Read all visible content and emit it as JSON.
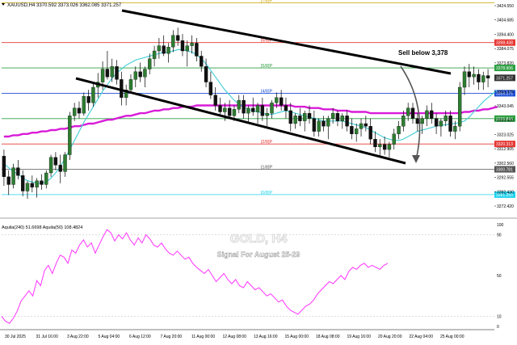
{
  "header": {
    "symbol_line": "XAUUSD,H4  3370.592  3373.026  3362.085  3371.257"
  },
  "watermark": {
    "title": "GOLD, H4",
    "subtitle": "Signal For August 25-29"
  },
  "annotation": {
    "text": "Sell below 3,378"
  },
  "oscillator": {
    "label": "Aquila(240) 51.6698  Aquila(50) 108.4824"
  },
  "colors": {
    "candle_bull": "#2e7d32",
    "candle_bear": "#111111",
    "ma_fast": "#4dd0d8",
    "ma_slow": "#d81bd8",
    "oscillator": "#ff33ff",
    "channel": "#000000",
    "murrey_green": "#2ea043",
    "murrey_red": "#e53935",
    "murrey_blue": "#1e4fd8",
    "murrey_cyan": "#22d3ee",
    "murrey_gray": "#555555",
    "murrey_yellow": "#c9a400"
  },
  "chart_data": [
    {
      "type": "candlestick",
      "title": "",
      "ylim": [
        3265,
        3430
      ],
      "y_ticks": [
        "3424.550",
        "3404.685",
        "3394.400",
        "3384.075",
        "3373.820",
        "3363.560",
        "3353.375",
        "3343.045",
        "3333.420",
        "3323.025",
        "3312.905",
        "3302.560",
        "3292.555",
        "3282.430",
        "3272.420"
      ],
      "x_ticks": [
        "30 Jul 2025",
        "31 Jul 16:00",
        "3 Aug 22:00",
        "5 Aug 04:00",
        "6 Aug 12:00",
        "7 Aug 20:00",
        "11 Aug 00:00",
        "12 Aug 08:00",
        "13 Aug 16:00",
        "15 Aug 00:00",
        "18 Aug 08:00",
        "19 Aug 16:00",
        "20 Aug 20:00",
        "22 Aug 04:00",
        "25 Aug 00:00"
      ],
      "levels": [
        {
          "label": "[7/8]P",
          "value": 3429.0,
          "color": "yellow",
          "price_label": ""
        },
        {
          "label": "[6/8]P",
          "value": 3398.438,
          "color": "red",
          "price_label": "3398.438"
        },
        {
          "label": "[5/8]P",
          "value": 3378.906,
          "color": "green",
          "price_label": "3378.906"
        },
        {
          "label": "[4/8]P",
          "value": 3359.375,
          "color": "blue",
          "price_label": "3359.375"
        },
        {
          "label": "",
          "value": 3339.844,
          "color": "green",
          "price_label": "3339.844"
        },
        {
          "label": "[2/8]P",
          "value": 3320.313,
          "color": "red",
          "price_label": "3320.313"
        },
        {
          "label": "[1/8]P",
          "value": 3300.781,
          "color": "gray",
          "price_label": "3300.781"
        },
        {
          "label": "[0/8]P",
          "value": 3281.25,
          "color": "cyan",
          "price_label": "3281.250"
        }
      ],
      "current_price": "3371.257",
      "candles": [
        [
          3311,
          3316,
          3288,
          3295
        ],
        [
          3295,
          3300,
          3281,
          3289
        ],
        [
          3289,
          3305,
          3286,
          3302
        ],
        [
          3302,
          3308,
          3293,
          3296
        ],
        [
          3296,
          3300,
          3280,
          3284
        ],
        [
          3284,
          3292,
          3278,
          3290
        ],
        [
          3290,
          3296,
          3283,
          3287
        ],
        [
          3287,
          3294,
          3279,
          3292
        ],
        [
          3292,
          3297,
          3285,
          3289
        ],
        [
          3289,
          3300,
          3286,
          3298
        ],
        [
          3298,
          3312,
          3295,
          3310
        ],
        [
          3310,
          3314,
          3300,
          3304
        ],
        [
          3304,
          3312,
          3290,
          3299
        ],
        [
          3299,
          3314,
          3295,
          3312
        ],
        [
          3312,
          3345,
          3308,
          3342
        ],
        [
          3342,
          3352,
          3338,
          3348
        ],
        [
          3348,
          3353,
          3340,
          3344
        ],
        [
          3344,
          3360,
          3342,
          3357
        ],
        [
          3357,
          3362,
          3346,
          3352
        ],
        [
          3352,
          3368,
          3349,
          3364
        ],
        [
          3364,
          3375,
          3356,
          3368
        ],
        [
          3368,
          3384,
          3362,
          3378
        ],
        [
          3378,
          3392,
          3370,
          3372
        ],
        [
          3372,
          3386,
          3368,
          3380
        ],
        [
          3380,
          3385,
          3366,
          3370
        ],
        [
          3370,
          3376,
          3350,
          3356
        ],
        [
          3356,
          3366,
          3350,
          3362
        ],
        [
          3362,
          3374,
          3359,
          3370
        ],
        [
          3370,
          3380,
          3364,
          3376
        ],
        [
          3376,
          3383,
          3368,
          3372
        ],
        [
          3372,
          3380,
          3364,
          3378
        ],
        [
          3378,
          3390,
          3374,
          3386
        ],
        [
          3386,
          3396,
          3380,
          3392
        ],
        [
          3392,
          3402,
          3386,
          3396
        ],
        [
          3396,
          3404,
          3388,
          3390
        ],
        [
          3390,
          3398,
          3383,
          3395
        ],
        [
          3395,
          3408,
          3391,
          3404
        ],
        [
          3404,
          3410,
          3396,
          3400
        ],
        [
          3400,
          3405,
          3388,
          3392
        ],
        [
          3392,
          3400,
          3380,
          3396
        ],
        [
          3396,
          3404,
          3390,
          3398
        ],
        [
          3398,
          3402,
          3384,
          3388
        ],
        [
          3388,
          3392,
          3376,
          3380
        ],
        [
          3380,
          3386,
          3364,
          3368
        ],
        [
          3368,
          3376,
          3355,
          3358
        ],
        [
          3358,
          3364,
          3346,
          3350
        ],
        [
          3350,
          3356,
          3342,
          3345
        ],
        [
          3345,
          3352,
          3338,
          3348
        ],
        [
          3348,
          3354,
          3340,
          3342
        ],
        [
          3342,
          3350,
          3338,
          3347
        ],
        [
          3347,
          3358,
          3344,
          3354
        ],
        [
          3354,
          3358,
          3340,
          3344
        ],
        [
          3344,
          3350,
          3336,
          3348
        ],
        [
          3348,
          3356,
          3342,
          3345
        ],
        [
          3345,
          3352,
          3336,
          3350
        ],
        [
          3350,
          3356,
          3338,
          3342
        ],
        [
          3342,
          3348,
          3334,
          3344
        ],
        [
          3344,
          3354,
          3340,
          3352
        ],
        [
          3352,
          3360,
          3348,
          3356
        ],
        [
          3356,
          3362,
          3346,
          3350
        ],
        [
          3350,
          3356,
          3340,
          3346
        ],
        [
          3346,
          3352,
          3330,
          3336
        ],
        [
          3336,
          3344,
          3332,
          3342
        ],
        [
          3342,
          3348,
          3334,
          3338
        ],
        [
          3338,
          3346,
          3330,
          3344
        ],
        [
          3344,
          3350,
          3336,
          3340
        ],
        [
          3340,
          3346,
          3326,
          3330
        ],
        [
          3330,
          3340,
          3326,
          3338
        ],
        [
          3338,
          3342,
          3330,
          3334
        ],
        [
          3334,
          3342,
          3324,
          3340
        ],
        [
          3340,
          3348,
          3336,
          3344
        ],
        [
          3344,
          3346,
          3334,
          3338
        ],
        [
          3338,
          3344,
          3332,
          3342
        ],
        [
          3342,
          3346,
          3330,
          3334
        ],
        [
          3334,
          3340,
          3324,
          3328
        ],
        [
          3328,
          3336,
          3322,
          3332
        ],
        [
          3332,
          3340,
          3326,
          3336
        ],
        [
          3336,
          3342,
          3330,
          3334
        ],
        [
          3334,
          3340,
          3320,
          3324
        ],
        [
          3324,
          3330,
          3314,
          3318
        ],
        [
          3318,
          3324,
          3310,
          3320
        ],
        [
          3320,
          3326,
          3312,
          3316
        ],
        [
          3316,
          3322,
          3310,
          3320
        ],
        [
          3320,
          3332,
          3316,
          3328
        ],
        [
          3328,
          3338,
          3324,
          3334
        ],
        [
          3334,
          3346,
          3330,
          3342
        ],
        [
          3342,
          3352,
          3338,
          3348
        ],
        [
          3348,
          3352,
          3336,
          3340
        ],
        [
          3340,
          3344,
          3330,
          3336
        ],
        [
          3336,
          3342,
          3328,
          3340
        ],
        [
          3340,
          3350,
          3334,
          3346
        ],
        [
          3346,
          3352,
          3336,
          3340
        ],
        [
          3340,
          3344,
          3328,
          3334
        ],
        [
          3334,
          3340,
          3326,
          3338
        ],
        [
          3338,
          3346,
          3334,
          3342
        ],
        [
          3342,
          3346,
          3326,
          3330
        ],
        [
          3330,
          3338,
          3324,
          3334
        ],
        [
          3334,
          3368,
          3330,
          3364
        ],
        [
          3364,
          3380,
          3358,
          3376
        ],
        [
          3376,
          3382,
          3364,
          3372
        ],
        [
          3372,
          3380,
          3366,
          3374
        ],
        [
          3374,
          3378,
          3362,
          3368
        ],
        [
          3368,
          3376,
          3362,
          3373
        ],
        [
          3373,
          3378,
          3364,
          3371
        ]
      ],
      "ma_fast": [
        3305,
        3302,
        3299,
        3297,
        3294,
        3292,
        3291,
        3290,
        3290,
        3291,
        3294,
        3298,
        3303,
        3309,
        3316,
        3323,
        3330,
        3337,
        3343,
        3349,
        3355,
        3361,
        3366,
        3371,
        3375,
        3378,
        3381,
        3383,
        3385,
        3386,
        3387,
        3388,
        3389,
        3390,
        3391,
        3391,
        3392,
        3393,
        3393,
        3392,
        3391,
        3389,
        3386,
        3382,
        3377,
        3372,
        3367,
        3362,
        3358,
        3354,
        3351,
        3349,
        3347,
        3346,
        3345,
        3344,
        3343,
        3343,
        3344,
        3345,
        3346,
        3345,
        3344,
        3343,
        3342,
        3341,
        3340,
        3339,
        3338,
        3338,
        3338,
        3338,
        3338,
        3337,
        3336,
        3335,
        3334,
        3333,
        3331,
        3329,
        3327,
        3325,
        3324,
        3323,
        3323,
        3324,
        3326,
        3328,
        3330,
        3331,
        3332,
        3333,
        3334,
        3335,
        3335,
        3336,
        3336,
        3337,
        3338,
        3341,
        3345,
        3349,
        3353,
        3356,
        3359,
        3362
      ],
      "ma_slow": [
        3326,
        3326,
        3327,
        3327,
        3328,
        3328,
        3329,
        3329,
        3330,
        3330,
        3331,
        3331,
        3332,
        3332,
        3333,
        3334,
        3334,
        3335,
        3336,
        3336,
        3337,
        3338,
        3339,
        3339,
        3340,
        3341,
        3342,
        3342,
        3343,
        3344,
        3344,
        3345,
        3346,
        3346,
        3347,
        3347,
        3348,
        3348,
        3349,
        3349,
        3349,
        3350,
        3350,
        3350,
        3350,
        3350,
        3350,
        3350,
        3350,
        3350,
        3350,
        3350,
        3350,
        3350,
        3350,
        3350,
        3350,
        3350,
        3350,
        3350,
        3350,
        3350,
        3349,
        3349,
        3349,
        3348,
        3348,
        3348,
        3347,
        3347,
        3347,
        3346,
        3346,
        3346,
        3345,
        3345,
        3345,
        3345,
        3344,
        3344,
        3344,
        3344,
        3344,
        3344,
        3344,
        3344,
        3344,
        3344,
        3344,
        3344,
        3344,
        3344,
        3344,
        3344,
        3344,
        3344,
        3344,
        3344,
        3345,
        3345,
        3346,
        3346,
        3347,
        3347,
        3348,
        3349
      ]
    },
    {
      "type": "line",
      "title": "",
      "ylim": [
        0,
        100
      ],
      "y_ticks": [
        "100",
        "90",
        "50",
        "10",
        "0"
      ],
      "series": [
        {
          "values": [
            10,
            5,
            3,
            8,
            15,
            25,
            30,
            35,
            30,
            45,
            40,
            55,
            60,
            52,
            62,
            70,
            68,
            62,
            75,
            72,
            80,
            85,
            78,
            82,
            72,
            80,
            88,
            95,
            92,
            84,
            90,
            86,
            92,
            85,
            80,
            87,
            82,
            90,
            86,
            80,
            78,
            82,
            76,
            72,
            70,
            74,
            70,
            66,
            68,
            62,
            58,
            55,
            52,
            56,
            50,
            44,
            48,
            52,
            46,
            42,
            46,
            40,
            38,
            44,
            40,
            36,
            38,
            34,
            30,
            32,
            28,
            24,
            26,
            20,
            16,
            14,
            12,
            16,
            20,
            22,
            26,
            32,
            36,
            40,
            44,
            42,
            46,
            50,
            46,
            54,
            58,
            56,
            60,
            62,
            58,
            60,
            58,
            56,
            60,
            62
          ]
        },
        {
          "values": [
            12,
            10,
            20,
            32,
            40,
            48,
            56,
            62,
            68,
            74,
            70,
            76,
            86,
            92,
            96,
            98,
            95,
            90,
            80,
            72,
            74,
            70,
            66,
            74,
            80,
            76
          ]
        }
      ]
    }
  ]
}
